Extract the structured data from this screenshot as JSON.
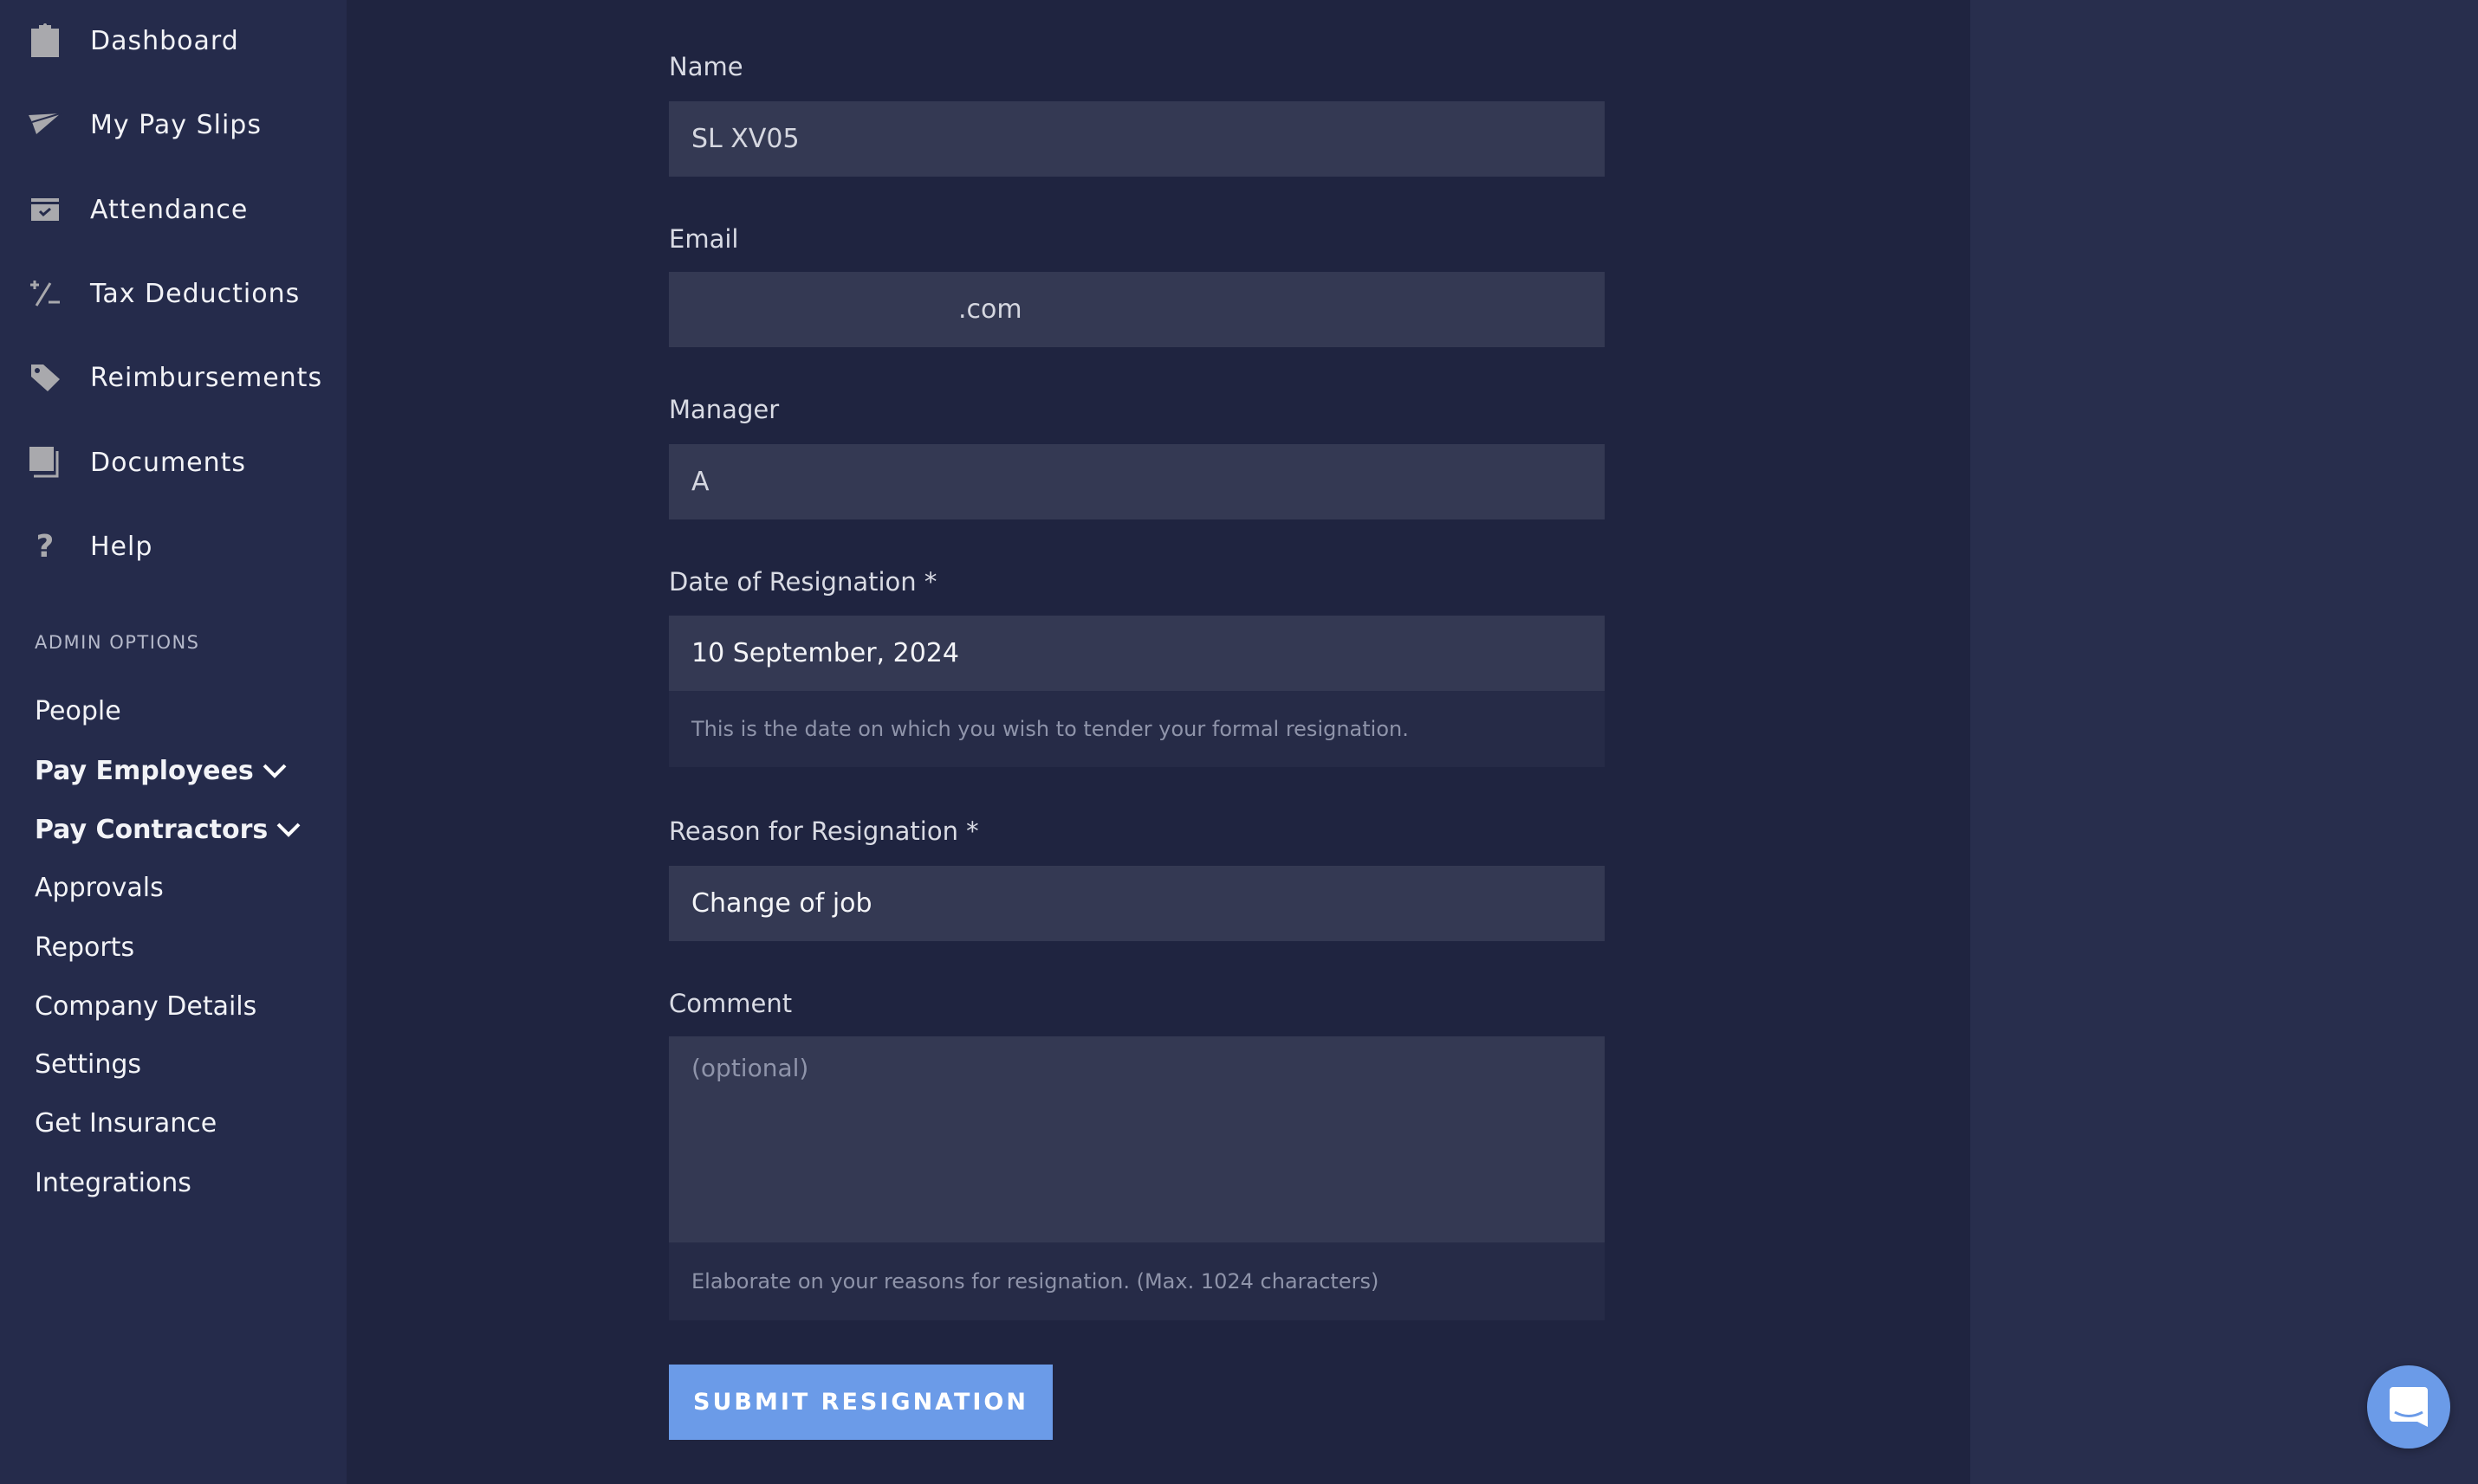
{
  "sidebar": {
    "nav": [
      {
        "label": "Dashboard",
        "icon": "clipboard-icon"
      },
      {
        "label": "My Pay Slips",
        "icon": "paper-plane-icon"
      },
      {
        "label": "Attendance",
        "icon": "calendar-check-icon"
      },
      {
        "label": "Tax Deductions",
        "icon": "plus-minus-icon"
      },
      {
        "label": "Reimbursements",
        "icon": "tag-icon"
      },
      {
        "label": "Documents",
        "icon": "documents-icon"
      },
      {
        "label": "Help",
        "icon": "question-icon"
      }
    ],
    "admin_heading": "ADMIN OPTIONS",
    "admin": [
      {
        "label": "People"
      },
      {
        "label": "Pay Employees"
      },
      {
        "label": "Pay Contractors"
      },
      {
        "label": "Approvals"
      },
      {
        "label": "Reports"
      },
      {
        "label": "Company Details"
      },
      {
        "label": "Settings"
      },
      {
        "label": "Get Insurance"
      },
      {
        "label": "Integrations"
      }
    ]
  },
  "form": {
    "name": {
      "label": "Name",
      "value": "SL XV05"
    },
    "email": {
      "label": "Email",
      "value": ".com"
    },
    "manager": {
      "label": "Manager",
      "value": "A"
    },
    "date": {
      "label": "Date of Resignation *",
      "value": "10 September, 2024",
      "help": "This is the date on which you wish to tender your formal resignation."
    },
    "reason": {
      "label": "Reason for Resignation *",
      "value": "Change of job"
    },
    "comment": {
      "label": "Comment",
      "placeholder": "(optional)",
      "help": "Elaborate on your reasons for resignation. (Max. 1024 characters)"
    },
    "submit_label": "SUBMIT RESIGNATION"
  },
  "colors": {
    "accent": "#6b9be8",
    "sidebar": "#252b4b",
    "main": "#1f2440",
    "input": "#343953"
  },
  "chat_icon": "chat-icon"
}
